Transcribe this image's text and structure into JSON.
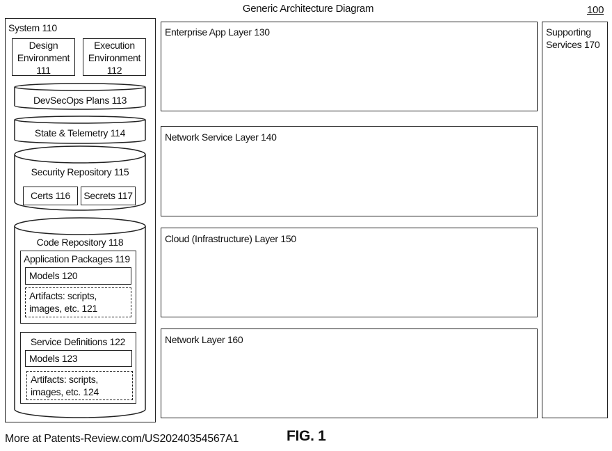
{
  "title": "Generic Architecture Diagram",
  "figure_ref": "100",
  "figure_caption": "FIG. 1",
  "footer_source": "More at Patents-Review.com/US20240354567A1",
  "system": {
    "label": "System 110",
    "design_env": {
      "line1": "Design",
      "line2": "Environment",
      "line3": "111"
    },
    "execution_env": {
      "line1": "Execution",
      "line2": "Environment",
      "line3": "112"
    },
    "devsecops": "DevSecOps Plans 113",
    "state_telemetry": "State & Telemetry 114",
    "security_repo": {
      "label": "Security Repository 115",
      "certs": "Certs 116",
      "secrets": "Secrets 117"
    },
    "code_repo": {
      "label": "Code Repository 118",
      "app_packages": {
        "label": "Application Packages 119",
        "models": "Models 120",
        "artifacts_line1": "Artifacts: scripts,",
        "artifacts_line2": "images, etc. 121"
      },
      "service_defs": {
        "label": "Service Definitions 122",
        "models": "Models 123",
        "artifacts_line1": "Artifacts: scripts,",
        "artifacts_line2": "images, etc. 124"
      }
    }
  },
  "layers": [
    {
      "label": "Enterprise App Layer 130"
    },
    {
      "label": "Network Service Layer 140"
    },
    {
      "label": "Cloud (Infrastructure) Layer 150"
    },
    {
      "label": "Network Layer 160"
    }
  ],
  "supporting_services": {
    "line1": "Supporting",
    "line2": "Services 170"
  }
}
